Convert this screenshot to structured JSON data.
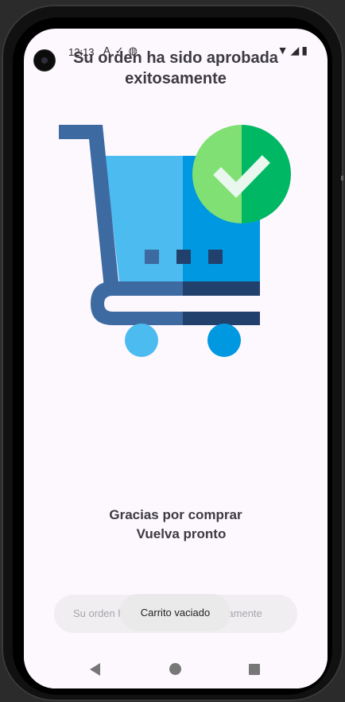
{
  "status_bar": {
    "time": "12:13",
    "notification_icons": [
      "A",
      "✓",
      "◍"
    ],
    "system_icons": [
      "▼",
      "◢",
      "▮"
    ]
  },
  "screen": {
    "title": "Su orden ha sido aprobada exitosamente",
    "thanks_line1": "Gracias por comprar",
    "thanks_line2": "Vuelva pronto",
    "input_placeholder": "Su orden ha sido aprobada exitosamente",
    "toast": "Carrito vaciado"
  },
  "illustration": {
    "icon": "shopping-cart-check-icon",
    "colors": {
      "cart_light": "#4cbbef",
      "cart_dark": "#0098e1",
      "frame_light": "#3e6aa2",
      "frame_dark": "#22406c",
      "check_light": "#81e073",
      "check_dark": "#00b864"
    }
  },
  "nav_bar": {
    "icons": [
      "back-icon",
      "home-icon",
      "recents-icon"
    ]
  }
}
